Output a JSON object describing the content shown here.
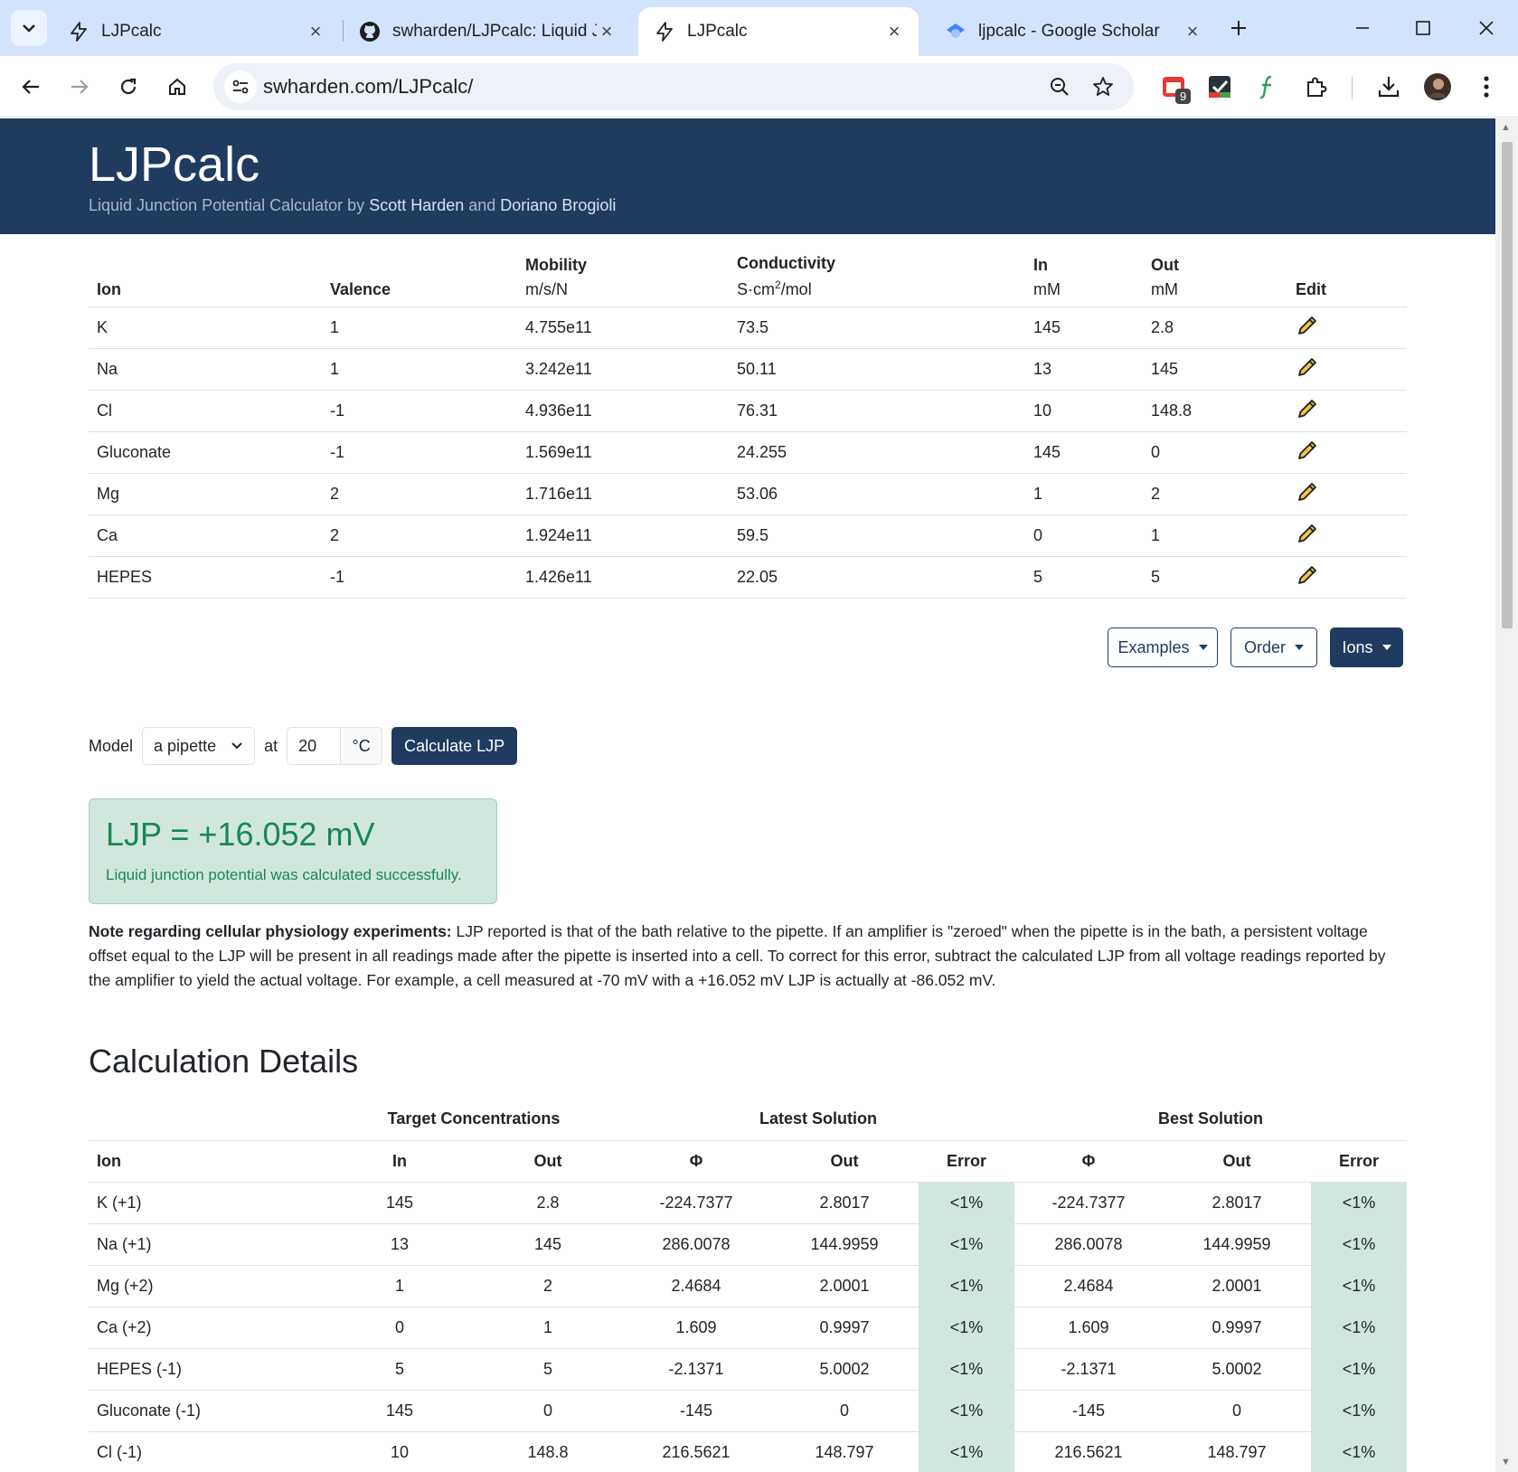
{
  "browser": {
    "tabs": [
      {
        "title": "LJPcalc",
        "icon": "bolt-icon",
        "active": false
      },
      {
        "title": "swharden/LJPcalc: Liquid Ju",
        "icon": "github-icon",
        "active": false
      },
      {
        "title": "LJPcalc",
        "icon": "bolt-icon",
        "active": true
      },
      {
        "title": "ljpcalc - Google Scholar",
        "icon": "scholar-icon",
        "active": false
      }
    ],
    "url": "swharden.com/LJPcalc/",
    "extension_badge": "9"
  },
  "header": {
    "title": "LJPcalc",
    "subtitle_prefix": "Liquid Junction Potential Calculator by ",
    "author1": "Scott Harden",
    "and": " and ",
    "author2": "Doriano Brogioli"
  },
  "ion_table": {
    "headers": {
      "ion": "Ion",
      "valence": "Valence",
      "mobility": "Mobility",
      "mobility_unit": "m/s/N",
      "conductivity": "Conductivity",
      "conductivity_unit": "S·cm",
      "conductivity_unit_sup": "2",
      "conductivity_unit_tail": "/mol",
      "in": "In",
      "in_unit": "mM",
      "out": "Out",
      "out_unit": "mM",
      "edit": "Edit"
    },
    "rows": [
      {
        "ion": "K",
        "valence": "1",
        "mobility": "4.755e11",
        "conductivity": "73.5",
        "in": "145",
        "out": "2.8"
      },
      {
        "ion": "Na",
        "valence": "1",
        "mobility": "3.242e11",
        "conductivity": "50.11",
        "in": "13",
        "out": "145"
      },
      {
        "ion": "Cl",
        "valence": "-1",
        "mobility": "4.936e11",
        "conductivity": "76.31",
        "in": "10",
        "out": "148.8"
      },
      {
        "ion": "Gluconate",
        "valence": "-1",
        "mobility": "1.569e11",
        "conductivity": "24.255",
        "in": "145",
        "out": "0"
      },
      {
        "ion": "Mg",
        "valence": "2",
        "mobility": "1.716e11",
        "conductivity": "53.06",
        "in": "1",
        "out": "2"
      },
      {
        "ion": "Ca",
        "valence": "2",
        "mobility": "1.924e11",
        "conductivity": "59.5",
        "in": "0",
        "out": "1"
      },
      {
        "ion": "HEPES",
        "valence": "-1",
        "mobility": "1.426e11",
        "conductivity": "22.05",
        "in": "5",
        "out": "5"
      }
    ]
  },
  "buttons": {
    "examples": "Examples",
    "order": "Order",
    "ions": "Ions"
  },
  "model": {
    "label": "Model",
    "selected": "a pipette",
    "at": "at",
    "temperature": "20",
    "temperature_unit": "°C",
    "calculate": "Calculate LJP"
  },
  "result": {
    "value": "LJP = +16.052 mV",
    "message": "Liquid junction potential was calculated successfully."
  },
  "note": {
    "bold": "Note regarding cellular physiology experiments:",
    "text": " LJP reported is that of the bath relative to the pipette. If an amplifier is \"zeroed\" when the pipette is in the bath, a persistent voltage offset equal to the LJP will be present in all readings made after the pipette is inserted into a cell. To correct for this error, subtract the calculated LJP from all voltage readings reported by the amplifier to yield the actual voltage. For example, a cell measured at -70 mV with a +16.052 mV LJP is actually at -86.052 mV."
  },
  "details": {
    "title": "Calculation Details",
    "groups": {
      "target": "Target Concentrations",
      "latest": "Latest Solution",
      "best": "Best Solution"
    },
    "headers": [
      "Ion",
      "In",
      "Out",
      "Φ",
      "Out",
      "Error",
      "Φ",
      "Out",
      "Error"
    ],
    "rows": [
      [
        "K (+1)",
        "145",
        "2.8",
        "-224.7377",
        "2.8017",
        "<1%",
        "-224.7377",
        "2.8017",
        "<1%"
      ],
      [
        "Na (+1)",
        "13",
        "145",
        "286.0078",
        "144.9959",
        "<1%",
        "286.0078",
        "144.9959",
        "<1%"
      ],
      [
        "Mg (+2)",
        "1",
        "2",
        "2.4684",
        "2.0001",
        "<1%",
        "2.4684",
        "2.0001",
        "<1%"
      ],
      [
        "Ca (+2)",
        "0",
        "1",
        "1.609",
        "0.9997",
        "<1%",
        "1.609",
        "0.9997",
        "<1%"
      ],
      [
        "HEPES (-1)",
        "5",
        "5",
        "-2.1371",
        "5.0002",
        "<1%",
        "-2.1371",
        "5.0002",
        "<1%"
      ],
      [
        "Gluconate (-1)",
        "145",
        "0",
        "-145",
        "0",
        "<1%",
        "-145",
        "0",
        "<1%"
      ],
      [
        "Cl (-1)",
        "10",
        "148.8",
        "216.5621",
        "148.797",
        "<1%",
        "216.5621",
        "148.797",
        "<1%"
      ]
    ]
  }
}
